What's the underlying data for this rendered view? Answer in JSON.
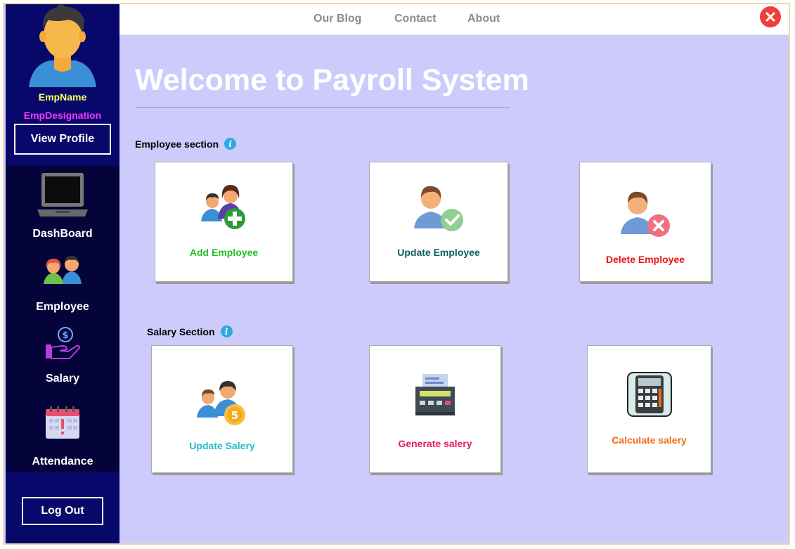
{
  "profile": {
    "name": "EmpName",
    "designation": "EmpDesignation",
    "view_profile_label": "View Profile"
  },
  "sidebar": {
    "items": [
      {
        "label": "DashBoard",
        "icon": "laptop-icon"
      },
      {
        "label": "Employee",
        "icon": "people-icon"
      },
      {
        "label": "Salary",
        "icon": "salary-hand-icon"
      },
      {
        "label": "Attendance",
        "icon": "calendar-icon"
      }
    ],
    "logout_label": "Log Out"
  },
  "topnav": {
    "links": [
      "Our Blog",
      "Contact",
      "About"
    ],
    "close_icon": "close-icon"
  },
  "main": {
    "title": "Welcome to Payroll System",
    "employee_section": {
      "label": "Employee section",
      "cards": [
        {
          "label": "Add Employee",
          "color": "#22c022",
          "icon": "add-employee-icon"
        },
        {
          "label": "Update Employee",
          "color": "#0f5c5c",
          "icon": "update-employee-icon"
        },
        {
          "label": "Delete Employee",
          "color": "#ee1111",
          "icon": "delete-employee-icon"
        }
      ]
    },
    "salary_section": {
      "label": "Salary Section",
      "cards": [
        {
          "label": "Update Salery",
          "color": "#1fbfc6",
          "icon": "update-salary-icon"
        },
        {
          "label": "Generate salery",
          "color": "#e8156b",
          "icon": "cash-register-icon"
        },
        {
          "label": "Calculate salery",
          "color": "#f06a14",
          "icon": "calculator-icon"
        }
      ]
    }
  },
  "colors": {
    "sidebar": "#08086a",
    "sidebar_nav": "#04043a",
    "content_bg": "#cccbfb",
    "close": "#ee3f3a"
  }
}
